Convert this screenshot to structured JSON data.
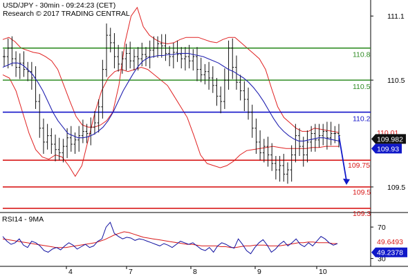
{
  "header": {
    "title": "USD/JPY - 30min - 09:24:23 (CET)",
    "subtitle": "Research © 2017 TRADING CENTRAL"
  },
  "colors": {
    "resistance": "#2e8b22",
    "pivot": "#1010c8",
    "support": "#d81818",
    "bands": "#e02020",
    "moving_average": "#2020b0",
    "price_bars": "#111111",
    "rsi_line": "#1010a0",
    "rsi_signal": "#d81818",
    "price_badge": "#111111",
    "band_badge": "#1018c8",
    "upper_badge": "#d81818",
    "arrow": "#1018c8"
  },
  "chart_data": [
    {
      "type": "candlestick",
      "panel": "price",
      "ylim": [
        109.28,
        111.25
      ],
      "y_ticks": [
        109.5,
        110.5,
        111.1
      ],
      "y_tick_labels": [
        "109.5",
        "110.5",
        "111.1"
      ],
      "x_ticks": [
        "4",
        "7",
        "8",
        "9",
        "10"
      ],
      "levels": [
        {
          "value": 110.8,
          "label": "110.8",
          "role": "resistance"
        },
        {
          "value": 110.5,
          "label": "110.5",
          "role": "resistance"
        },
        {
          "value": 110.2,
          "label": "110.2",
          "role": "pivot"
        },
        {
          "value": 109.75,
          "label": "109.75",
          "role": "support"
        },
        {
          "value": 109.5,
          "label": "109.5",
          "role": "support"
        },
        {
          "value": 109.3,
          "label": "109.3",
          "role": "support"
        }
      ],
      "last_values": [
        {
          "label": "110.01",
          "role": "upper_badge"
        },
        {
          "label": "109.982",
          "role": "price_badge"
        },
        {
          "label": "109.93",
          "role": "band_badge"
        }
      ],
      "close_series": [
        110.72,
        110.8,
        110.7,
        110.62,
        110.66,
        110.6,
        110.58,
        110.52,
        110.3,
        110.05,
        109.92,
        109.98,
        109.9,
        109.85,
        109.82,
        109.88,
        109.96,
        109.9,
        109.94,
        109.98,
        110.02,
        110.0,
        110.06,
        110.1,
        110.25,
        110.6,
        110.92,
        110.85,
        110.72,
        110.65,
        110.7,
        110.75,
        110.68,
        110.72,
        110.7,
        110.74,
        110.72,
        110.78,
        110.8,
        110.84,
        110.82,
        110.75,
        110.72,
        110.76,
        110.74,
        110.7,
        110.72,
        110.68,
        110.72,
        110.6,
        110.55,
        110.58,
        110.52,
        110.45,
        110.35,
        110.3,
        110.5,
        110.8,
        110.62,
        110.48,
        110.4,
        110.32,
        110.2,
        110.05,
        109.92,
        109.82,
        109.88,
        109.8,
        109.72,
        109.66,
        109.7,
        109.62,
        109.66,
        109.8,
        109.98,
        109.88,
        109.8,
        109.92,
        110.0,
        109.94,
        109.98,
        110.02,
        109.96,
        110.0,
        110.0,
        109.98
      ],
      "moving_average": [
        110.62,
        110.64,
        110.66,
        110.66,
        110.64,
        110.6,
        110.55,
        110.48,
        110.4,
        110.3,
        110.2,
        110.12,
        110.06,
        110.0,
        109.98,
        109.96,
        109.96,
        109.97,
        109.99,
        110.02,
        110.06,
        110.12,
        110.2,
        110.3,
        110.4,
        110.48,
        110.56,
        110.63,
        110.68,
        110.71,
        110.72,
        110.73,
        110.73,
        110.74,
        110.74,
        110.75,
        110.75,
        110.75,
        110.74,
        110.73,
        110.72,
        110.7,
        110.68,
        110.66,
        110.63,
        110.6,
        110.58,
        110.55,
        110.52,
        110.48,
        110.43,
        110.37,
        110.3,
        110.22,
        110.14,
        110.07,
        110.02,
        109.98,
        109.95,
        109.93,
        109.93,
        109.94,
        109.95,
        109.96,
        109.96,
        109.95,
        109.94,
        109.93
      ],
      "upper_band": [
        110.88,
        110.9,
        110.86,
        110.8,
        110.78,
        110.76,
        110.75,
        110.72,
        110.68,
        110.6,
        110.45,
        110.3,
        110.16,
        110.08,
        110.06,
        110.06,
        110.08,
        110.12,
        110.2,
        110.45,
        110.85,
        111.1,
        111.18,
        111.0,
        110.92,
        110.88,
        110.85,
        110.84,
        110.85,
        110.88,
        110.9,
        110.9,
        110.9,
        110.88,
        110.86,
        110.85,
        110.88,
        110.9,
        110.9,
        110.85,
        110.8,
        110.75,
        110.7,
        110.6,
        110.42,
        110.25,
        110.15,
        110.1,
        110.05,
        110.02,
        110.02,
        110.05,
        110.04,
        110.03,
        110.02,
        110.01
      ],
      "lower_band": [
        110.55,
        110.52,
        110.4,
        110.2,
        110.0,
        109.85,
        109.78,
        109.76,
        109.8,
        109.78,
        109.7,
        109.6,
        109.7,
        109.95,
        110.2,
        110.4,
        110.52,
        110.58,
        110.6,
        110.58,
        110.6,
        110.62,
        110.6,
        110.55,
        110.5,
        110.45,
        110.35,
        110.25,
        110.15,
        109.98,
        109.8,
        109.72,
        109.7,
        109.68,
        109.7,
        109.74,
        109.8,
        109.84,
        109.85,
        109.86,
        109.87,
        109.88,
        109.87,
        109.86,
        109.86,
        109.86,
        109.86,
        109.87,
        109.87,
        109.88,
        109.88,
        109.88
      ]
    },
    {
      "type": "line",
      "panel": "indicator",
      "title": "RSI14 - 9MA",
      "ylim": [
        20,
        85
      ],
      "y_ticks": [
        70,
        30
      ],
      "y_tick_labels": [
        "70",
        "30"
      ],
      "series": [
        {
          "role": "rsi",
          "values": [
            58,
            52,
            48,
            50,
            55,
            47,
            44,
            52,
            50,
            46,
            40,
            38,
            42,
            44,
            41,
            46,
            50,
            47,
            42,
            45,
            48,
            44,
            46,
            52,
            55,
            70,
            76,
            62,
            58,
            55,
            57,
            56,
            53,
            55,
            54,
            52,
            50,
            48,
            46,
            49,
            47,
            44,
            48,
            52,
            50,
            48,
            50,
            46,
            42,
            40,
            44,
            38,
            46,
            50,
            48,
            45,
            43,
            55,
            48,
            40,
            36,
            44,
            50,
            54,
            47,
            38,
            42,
            48,
            52,
            46,
            50,
            55,
            48,
            45,
            50,
            46,
            52,
            58,
            55,
            50,
            47,
            49
          ]
        },
        {
          "role": "signal",
          "values": [
            55,
            54,
            53,
            52,
            51,
            50,
            49,
            48,
            47,
            46,
            45,
            44,
            44,
            44,
            45,
            46,
            47,
            48,
            49,
            50,
            52,
            54,
            57,
            60,
            62,
            64,
            63,
            61,
            59,
            57,
            56,
            55,
            54,
            53,
            52,
            51,
            50,
            49,
            48,
            48,
            47,
            46,
            46,
            46,
            46,
            45,
            45,
            44,
            44,
            45,
            46,
            46,
            47,
            47,
            47,
            46,
            46,
            46,
            47,
            48,
            49,
            50,
            50,
            51,
            51,
            50,
            50,
            50,
            49,
            49
          ]
        }
      ],
      "last_values": [
        {
          "label": "49.6493",
          "role": "signal_badge"
        },
        {
          "label": "49.2378",
          "role": "rsi_badge"
        }
      ]
    }
  ]
}
